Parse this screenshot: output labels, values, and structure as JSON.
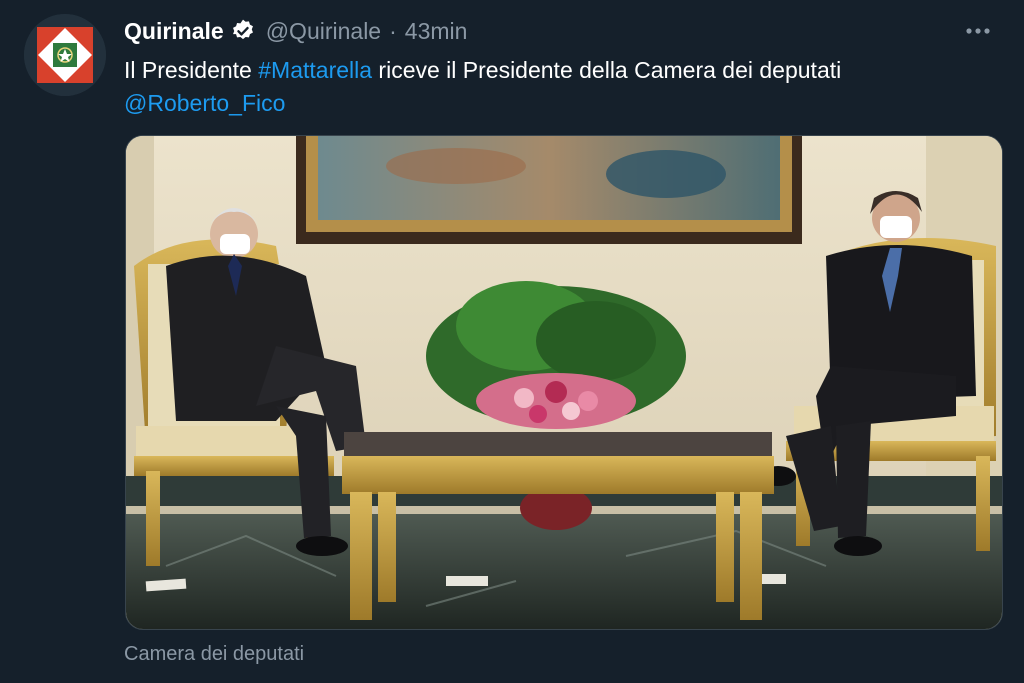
{
  "tweet": {
    "display_name": "Quirinale",
    "handle": "@Quirinale",
    "separator": "·",
    "time": "43min",
    "verified_icon": "verified-badge-icon",
    "more_icon": "more-dots-icon",
    "text_before": "Il Presidente ",
    "hashtag": "#Mattarella",
    "text_after": " riceve il Presidente della Camera dei deputati",
    "mention": "@Roberto_Fico",
    "media_caption": "Camera dei deputati"
  },
  "colors": {
    "background": "#15202b",
    "link": "#1d9bf0",
    "secondary_text": "#8b98a5",
    "avatar_red": "#d8412c",
    "avatar_green": "#2f7a3d"
  }
}
